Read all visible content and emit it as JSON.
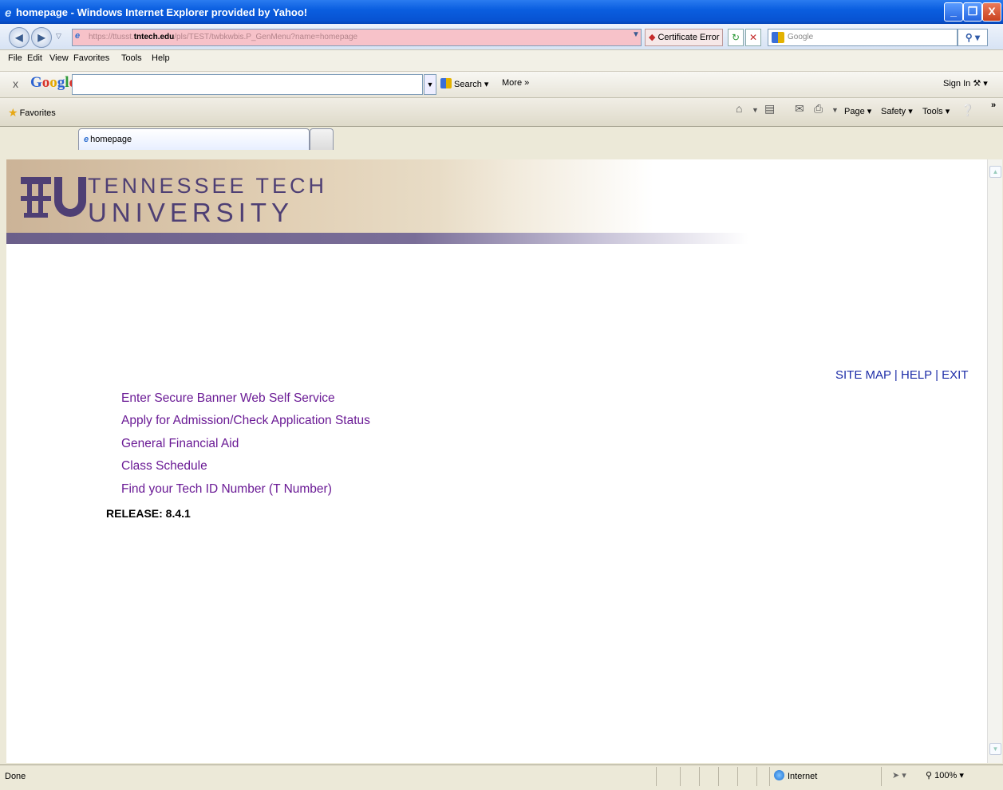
{
  "window": {
    "title": "homepage - Windows Internet Explorer provided by Yahoo!",
    "minimize_glyph": "_",
    "maximize_glyph": "❐",
    "close_glyph": "X"
  },
  "address_bar": {
    "url_prefix": "https://ttusst.",
    "url_host": "tntech.edu",
    "url_suffix": "/pls/TEST/twbkwbis.P_GenMenu?name=homepage",
    "certificate_error": "Certificate Error",
    "search_placeholder": "Google",
    "colors": {
      "error_bg": "#f7c2c9"
    }
  },
  "menu_bar": {
    "items": [
      "File",
      "Edit",
      "View",
      "Favorites",
      "Tools",
      "Help"
    ]
  },
  "google_toolbar": {
    "close": "x",
    "logo": "Google",
    "search_label": "Search",
    "more_label": "More »",
    "sign_in_label": "Sign In"
  },
  "favorites_bar": {
    "favorites_label": "Favorites",
    "tab_label": "homepage",
    "commands": {
      "page": "Page",
      "safety": "Safety",
      "tools": "Tools"
    }
  },
  "banner": {
    "line1": "TENNESSEE TECH",
    "line2": "UNIVERSITY",
    "colors": {
      "brand_purple": "#4e3f74"
    }
  },
  "top_nav": {
    "site_map": "SITE MAP",
    "help": "HELP",
    "exit": "EXIT",
    "separator": "|"
  },
  "main_menu": {
    "links": [
      "Enter Secure Banner Web Self Service",
      "Apply for Admission/Check Application Status",
      "General Financial Aid",
      "Class Schedule",
      "Find your Tech ID Number (T Number)"
    ],
    "colors": {
      "visited_link": "#6a1a95",
      "link": "#1e2ea8"
    }
  },
  "release": "RELEASE: 8.4.1",
  "status_bar": {
    "status": "Done",
    "zone": "Internet",
    "zoom": "100%"
  }
}
